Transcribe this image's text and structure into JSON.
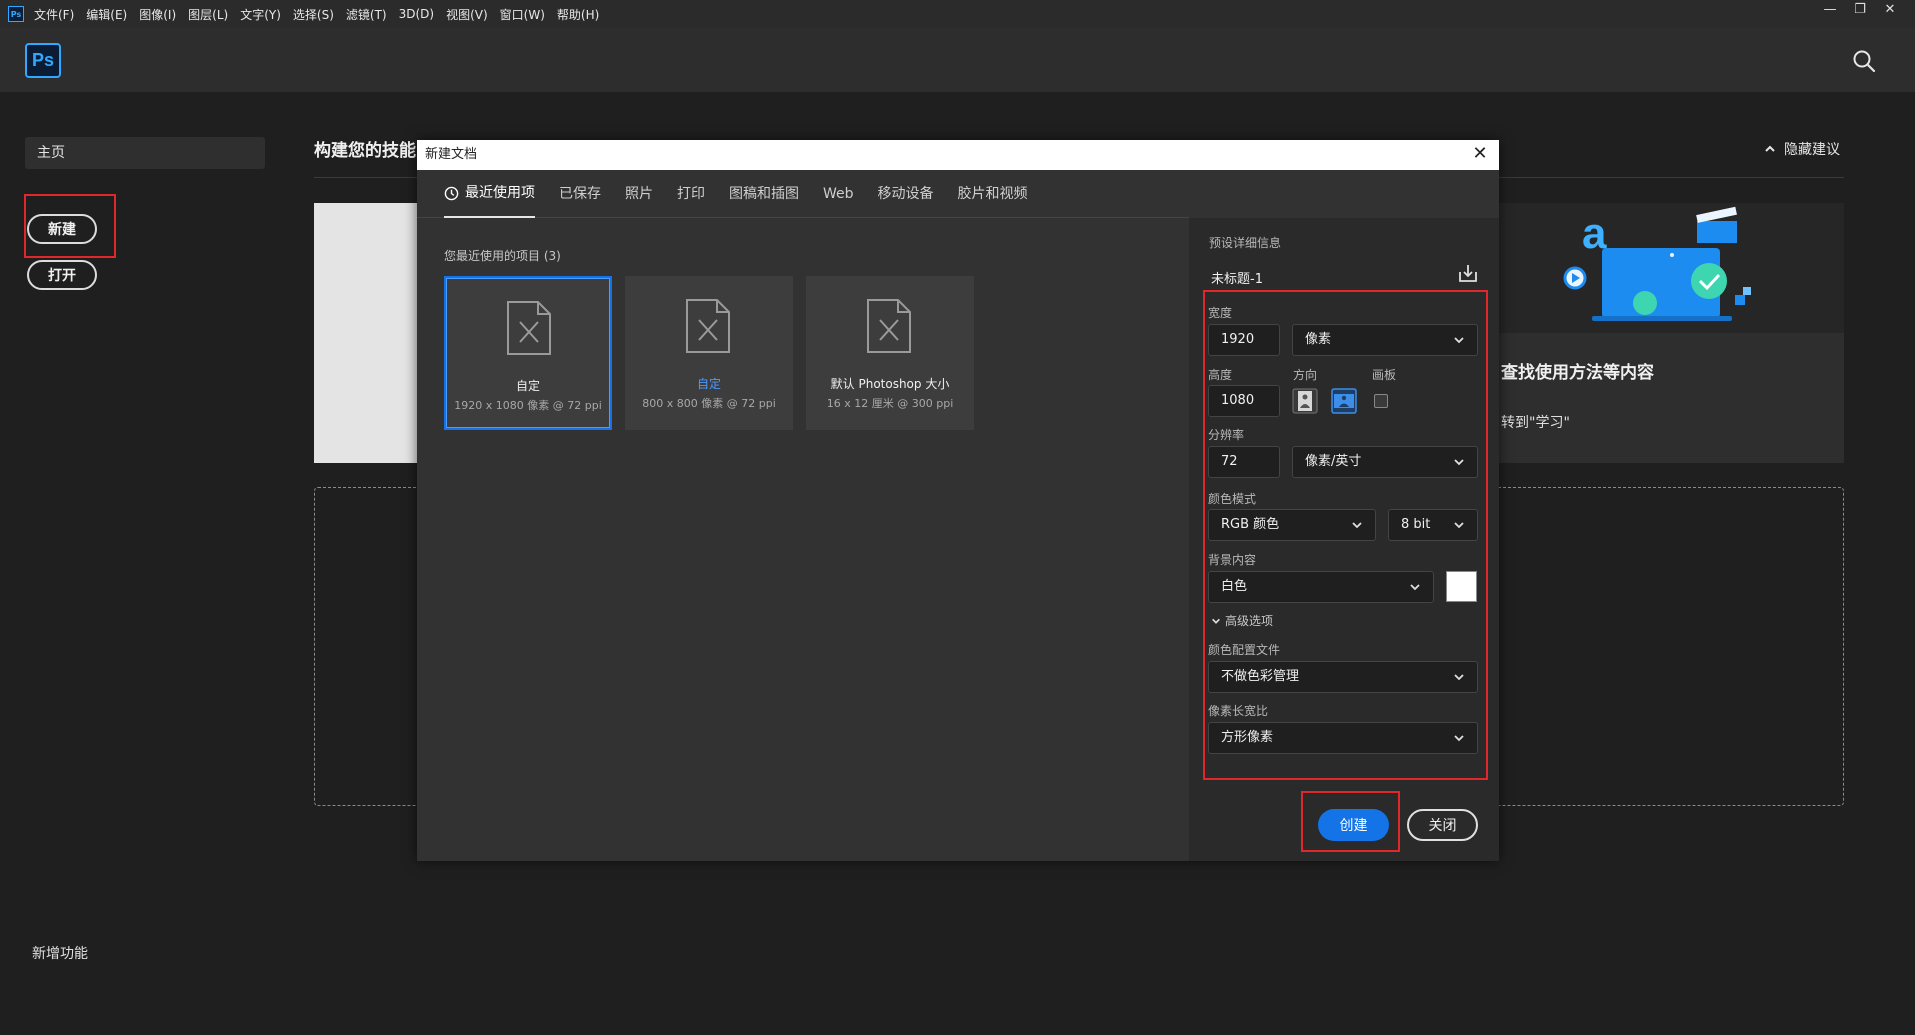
{
  "menubar": {
    "app_icon": "Ps",
    "items": [
      "文件(F)",
      "编辑(E)",
      "图像(I)",
      "图层(L)",
      "文字(Y)",
      "选择(S)",
      "滤镜(T)",
      "3D(D)",
      "视图(V)",
      "窗口(W)",
      "帮助(H)"
    ],
    "window_controls": [
      "—",
      "❐",
      "✕"
    ]
  },
  "header": {
    "logo": "Ps",
    "search_icon": "search-icon"
  },
  "sidebar": {
    "home": "主页",
    "new": "新建",
    "open": "打开",
    "new_features": "新增功能"
  },
  "main": {
    "title": "构建您的技能",
    "hide_suggestions": "隐藏建议",
    "card_title": "查找使用方法等内容",
    "card_sub": "转到\"学习\""
  },
  "dialog": {
    "title": "新建文档",
    "tabs": [
      "最近使用项",
      "已保存",
      "照片",
      "打印",
      "图稿和插图",
      "Web",
      "移动设备",
      "胶片和视频"
    ],
    "recent_label": "您最近使用的项目 (3)",
    "presets": [
      {
        "name": "自定",
        "dims": "1920 x 1080 像素 @ 72 ppi"
      },
      {
        "name": "自定",
        "dims": "800 x 800 像素 @ 72 ppi"
      },
      {
        "name": "默认 Photoshop 大小",
        "dims": "16 x 12 厘米 @ 300 ppi"
      }
    ],
    "details": {
      "section_label": "预设详细信息",
      "doc_name": "未标题-1",
      "width_label": "宽度",
      "width_value": "1920",
      "width_unit": "像素",
      "height_label": "高度",
      "height_value": "1080",
      "orientation_label": "方向",
      "artboard_label": "画板",
      "resolution_label": "分辨率",
      "resolution_value": "72",
      "resolution_unit": "像素/英寸",
      "color_mode_label": "颜色模式",
      "color_mode": "RGB 颜色",
      "bit_depth": "8 bit",
      "background_label": "背景内容",
      "background": "白色",
      "advanced": "高级选项",
      "profile_label": "颜色配置文件",
      "profile": "不做色彩管理",
      "pixel_aspect_label": "像素长宽比",
      "pixel_aspect": "方形像素"
    },
    "create": "创建",
    "close": "关闭"
  },
  "colors": {
    "accent": "#1473e6",
    "highlight": "#e0282c",
    "ps_blue": "#31a8ff"
  }
}
